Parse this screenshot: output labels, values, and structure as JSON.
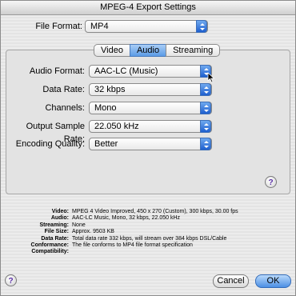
{
  "window": {
    "title": "MPEG-4 Export Settings"
  },
  "file_format": {
    "label": "File Format:",
    "value": "MP4"
  },
  "tabs": [
    {
      "label": "Video",
      "active": false
    },
    {
      "label": "Audio",
      "active": true
    },
    {
      "label": "Streaming",
      "active": false
    }
  ],
  "audio": {
    "format": {
      "label": "Audio Format:",
      "value": "AAC-LC (Music)"
    },
    "data_rate": {
      "label": "Data Rate:",
      "value": "32 kbps"
    },
    "channels": {
      "label": "Channels:",
      "value": "Mono"
    },
    "sample_rate": {
      "label": "Output Sample Rate:",
      "value": "22.050 kHz"
    },
    "quality": {
      "label": "Encoding Quality:",
      "value": "Better"
    }
  },
  "summary": [
    {
      "key": "Video:",
      "value": "MPEG 4 Video Improved, 450 x 270 (Custom), 300 kbps, 30.00 fps"
    },
    {
      "key": "Audio:",
      "value": "AAC-LC Music, Mono, 32 kbps, 22.050 kHz"
    },
    {
      "key": "Streaming:",
      "value": "None"
    },
    {
      "key": "File Size:",
      "value": "Approx. 9503 KB"
    },
    {
      "key": "Data Rate:",
      "value": "Total data rate 332 kbps, will stream over 384 kbps DSL/Cable"
    },
    {
      "key": "Conformance:",
      "value": "The file conforms to MP4 file format specification"
    },
    {
      "key": "Compatibility:",
      "value": ""
    }
  ],
  "buttons": {
    "cancel": "Cancel",
    "ok": "OK",
    "help": "?"
  },
  "colors": {
    "accent": "#3b7de0",
    "help_glyph": "#5a2fa5"
  }
}
